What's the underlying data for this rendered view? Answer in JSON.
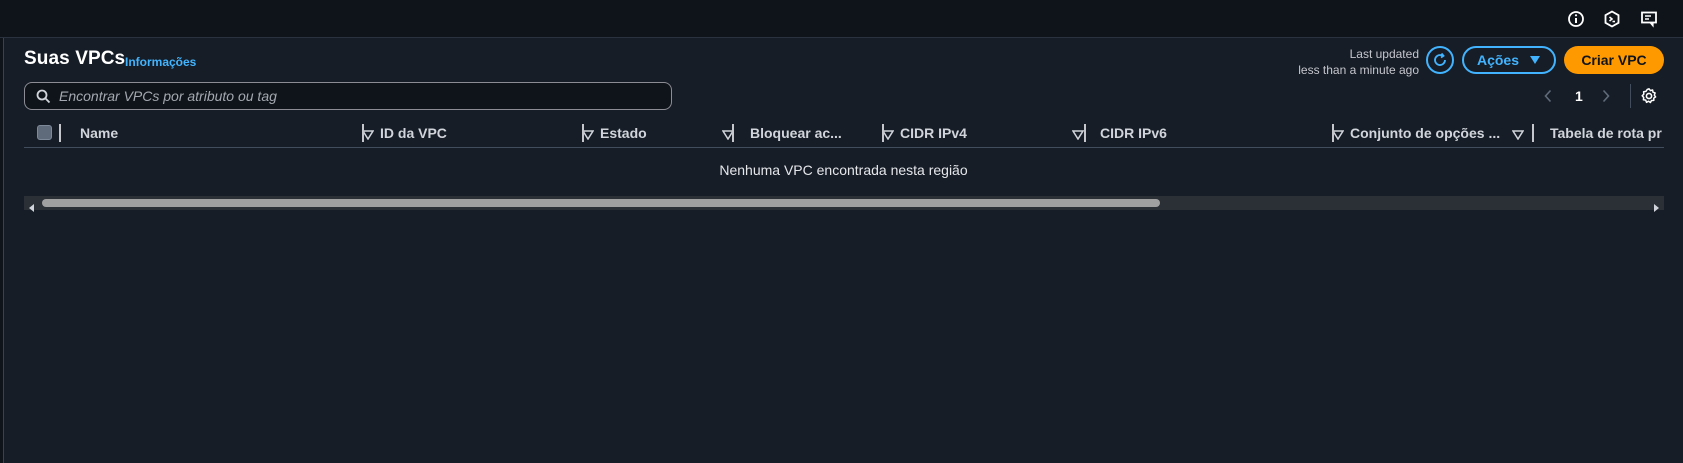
{
  "top_bar": {
    "icons": [
      "info-circle-icon",
      "cloudshell-icon",
      "feedback-icon"
    ]
  },
  "header": {
    "title": "Suas VPCs",
    "info_link": "Informações",
    "last_updated_line1": "Last updated",
    "last_updated_line2": "less than a minute ago",
    "actions_label": "Ações",
    "create_label": "Criar VPC"
  },
  "search": {
    "placeholder": "Encontrar VPCs por atributo ou tag",
    "value": ""
  },
  "pagination": {
    "current_page": "1"
  },
  "table": {
    "columns": [
      "Name",
      "ID da VPC",
      "Estado",
      "Bloquear ac...",
      "CIDR IPv4",
      "CIDR IPv6",
      "Conjunto de opções ...",
      "Tabela de rota pr"
    ],
    "empty_message": "Nenhuma VPC encontrada nesta região"
  },
  "colors": {
    "accent": "#42b4ff",
    "primary_button": "#ff9900",
    "background": "#161d26"
  }
}
